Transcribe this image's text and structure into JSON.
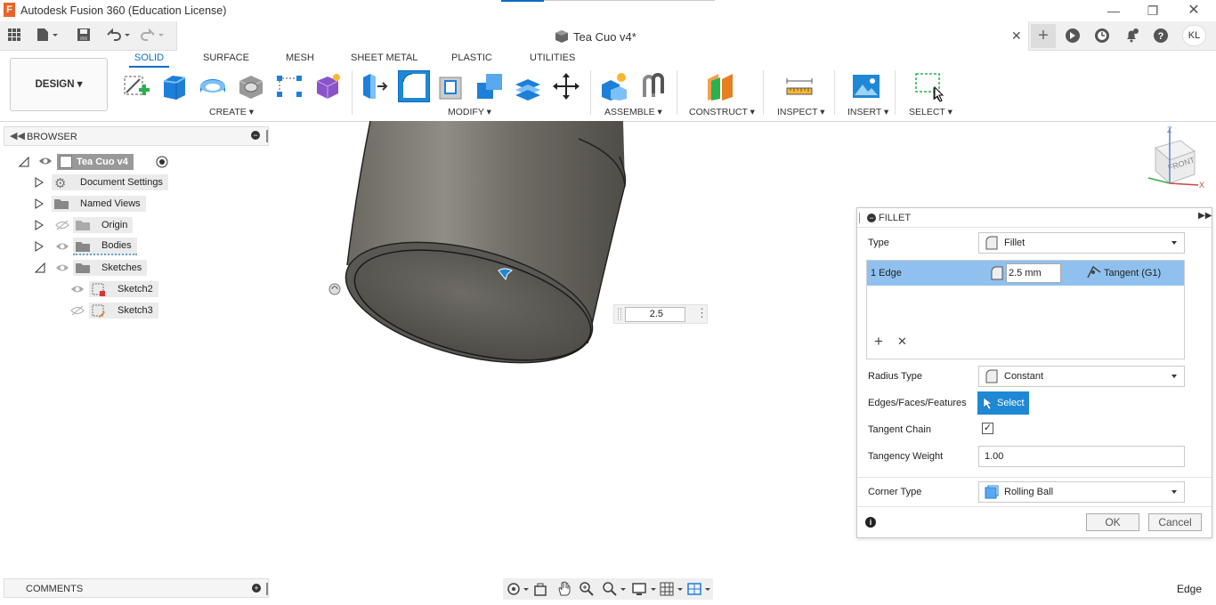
{
  "app": {
    "title": "Autodesk Fusion 360 (Education License)"
  },
  "document": {
    "tab_name": "Tea Cuo v4*"
  },
  "user": {
    "initials": "KL"
  },
  "workspace": {
    "label": "DESIGN"
  },
  "ribbon": {
    "tabs": [
      "SOLID",
      "SURFACE",
      "MESH",
      "SHEET METAL",
      "PLASTIC",
      "UTILITIES"
    ],
    "active_tab": "SOLID",
    "groups": [
      "CREATE",
      "MODIFY",
      "ASSEMBLE",
      "CONSTRUCT",
      "INSPECT",
      "INSERT",
      "SELECT"
    ]
  },
  "browser": {
    "title": "BROWSER",
    "root": "Tea Cuo v4",
    "items": [
      {
        "label": "Document Settings",
        "icon": "gear-icon"
      },
      {
        "label": "Named Views",
        "icon": "folder-icon"
      },
      {
        "label": "Origin",
        "icon": "folder-icon"
      },
      {
        "label": "Bodies",
        "icon": "folder-icon"
      },
      {
        "label": "Sketches",
        "icon": "folder-icon"
      },
      {
        "label": "Sketch2",
        "icon": "sketch-icon"
      },
      {
        "label": "Sketch3",
        "icon": "sketch-icon"
      }
    ]
  },
  "viewport": {
    "dimension_input": "2.5",
    "viewcube_label": "FRONT",
    "axes": {
      "z": "Z",
      "x": "X",
      "y": "Y"
    }
  },
  "fillet": {
    "title": "FILLET",
    "type_label": "Type",
    "type_value": "Fillet",
    "edge_row": {
      "count": "1 Edge",
      "radius": "2.5 mm",
      "continuity": "Tangent (G1)"
    },
    "radius_type_label": "Radius Type",
    "radius_type_value": "Constant",
    "edges_label": "Edges/Faces/Features",
    "select_button": "Select",
    "tangent_chain_label": "Tangent Chain",
    "tangent_chain_checked": true,
    "tangency_weight_label": "Tangency Weight",
    "tangency_weight_value": "1.00",
    "corner_type_label": "Corner Type",
    "corner_type_value": "Rolling Ball",
    "ok": "OK",
    "cancel": "Cancel"
  },
  "comments": {
    "title": "COMMENTS"
  },
  "status": {
    "selection_filter": "Edge"
  },
  "colors": {
    "accent": "#0e6cc4",
    "selected_row": "#8fc0ee",
    "select_button": "#1e88d5"
  }
}
